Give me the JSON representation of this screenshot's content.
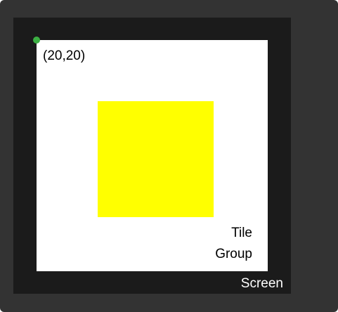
{
  "diagram": {
    "screen_label": "Screen",
    "group_label": "Group",
    "tile_label": "Tile",
    "origin_label": "(20,20)"
  },
  "colors": {
    "frame": "#333333",
    "screen": "#1b1b1b",
    "group": "#ffffff",
    "tile": "#ffff00",
    "origin_marker": "#3cb043"
  }
}
